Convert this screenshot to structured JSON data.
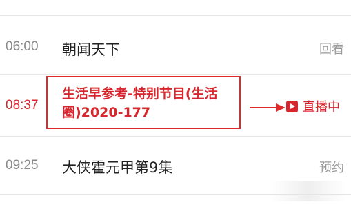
{
  "schedule": {
    "rows": [
      {
        "time": "06:00",
        "title": "朝闻天下",
        "action": "回看"
      },
      {
        "time": "08:37",
        "title": "生活早参考-特别节目(生活圈)2020-177",
        "action": "直播中",
        "live": true
      },
      {
        "time": "09:25",
        "title": "大侠霍元甲第9集",
        "action": "预约"
      }
    ]
  },
  "colors": {
    "live": "#d8262f",
    "annotation": "#e02a2a",
    "muted": "#9a9a9a"
  },
  "icons": {
    "live": "play-square-icon",
    "annotation": "arrow-right-icon"
  }
}
